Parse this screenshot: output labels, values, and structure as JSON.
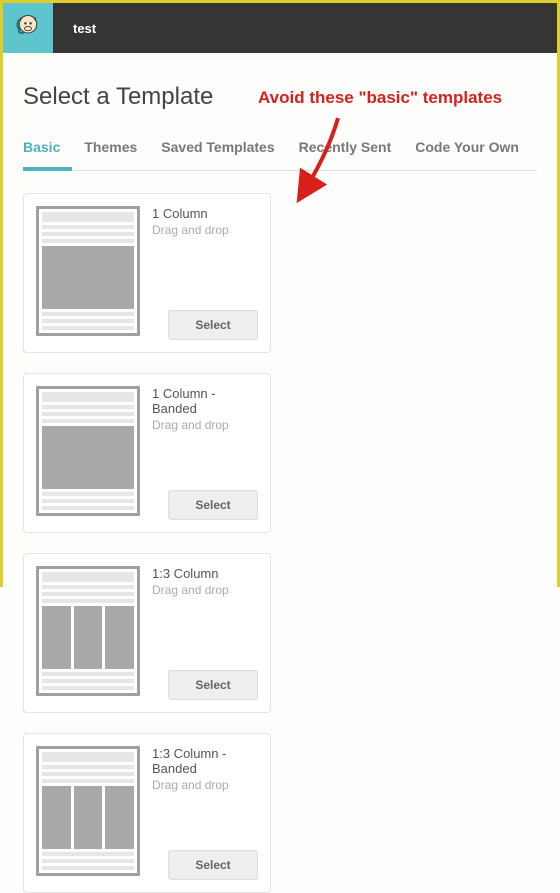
{
  "header": {
    "brand": "test"
  },
  "page": {
    "title": "Select a Template"
  },
  "annotation": "Avoid these \"basic\" templates",
  "tabs": [
    {
      "label": "Basic",
      "active": true
    },
    {
      "label": "Themes",
      "active": false
    },
    {
      "label": "Saved Templates",
      "active": false
    },
    {
      "label": "Recently Sent",
      "active": false
    },
    {
      "label": "Code Your Own",
      "active": false
    }
  ],
  "templates": [
    {
      "name": "1 Column",
      "desc": "Drag and drop",
      "button": "Select",
      "layout": "one"
    },
    {
      "name": "1 Column - Banded",
      "desc": "Drag and drop",
      "button": "Select",
      "layout": "one"
    },
    {
      "name": "1:3 Column",
      "desc": "Drag and drop",
      "button": "Select",
      "layout": "onethree"
    },
    {
      "name": "1:3 Column - Banded",
      "desc": "Drag and drop",
      "button": "Select",
      "layout": "onethree"
    }
  ]
}
